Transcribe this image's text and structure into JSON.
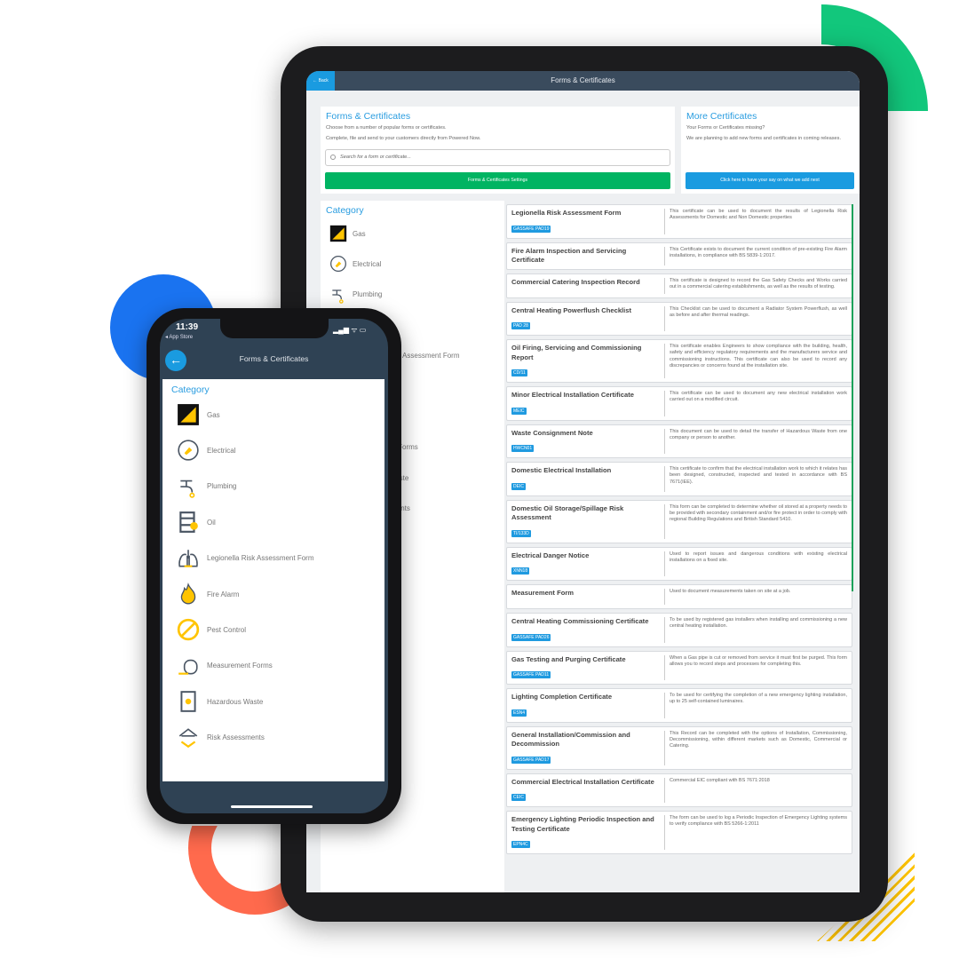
{
  "colors": {
    "accent": "#1a9be0",
    "green": "#00b462",
    "header": "#3a4b5d",
    "brand_yellow": "#ffc400"
  },
  "tablet": {
    "header": {
      "back_label": "← Back",
      "title": "Forms & Certificates"
    },
    "intro": {
      "title": "Forms & Certificates",
      "line1": "Choose from a number of popular forms or certificates.",
      "line2": "Complete, file and send to your customers directly from Powered Now.",
      "search_placeholder": "Search for a form or certificate...",
      "settings_button": "Forms & Certificates Settings"
    },
    "more": {
      "title": "More Certificates",
      "line1": "Your Forms or Certificates missing?",
      "line2": "We are planning to add new forms and certificates in coming releases.",
      "button": "Click here to have your say on what we add next"
    },
    "category_title": "Category",
    "forms": [
      {
        "title": "Legionella Risk Assessment Form",
        "tag": "GASSAFE PAD19",
        "desc": "This certificate can be used to document the results of Legionella Risk Assessments for Domestic and Non Domestic properties"
      },
      {
        "title": "Fire Alarm Inspection and Servicing Certificate",
        "tag": "",
        "desc": "This Certificate exists to document the current condition of pre-existing Fire Alarm installations, in compliance with BS 5839-1:2017."
      },
      {
        "title": "Commercial Catering Inspection Record",
        "tag": "",
        "desc": "This certificate is designed to record the Gas Safety Checks and Works carried out in a commercial catering establishments, as well as the results of testing."
      },
      {
        "title": "Central Heating Powerflush Checklist",
        "tag": "PAD 28",
        "desc": "This Checklist can be used to document a Radiator System Powerflush, as well as before and after thermal readings."
      },
      {
        "title": "Oil Firing, Servicing and Commissioning Report",
        "tag": "CD/11",
        "desc": "This certificate enables Engineers to show compliance with the building, health, safety and efficiency regulatory requirements and the manufacturers service and commissioning instructions. This certificate can also be used to record any discrepancies or concerns found at the installation site."
      },
      {
        "title": "Minor Electrical Installation Certificate",
        "tag": "MEIC",
        "desc": "This certificate can be used to document any new electrical installation work carried out on a modified circuit."
      },
      {
        "title": "Waste Consignment Note",
        "tag": "HWCN01",
        "desc": "This document can be used to detail the transfer of Hazardous Waste from one company or person to another."
      },
      {
        "title": "Domestic Electrical Installation",
        "tag": "DEIC",
        "desc": "This certificate to confirm that the electrical installation work to which it relates has been designed, constructed, inspected and tested in accordance with BS 7671(IEE)."
      },
      {
        "title": "Domestic Oil Storage/Spillage Risk Assessment",
        "tag": "TI/133D",
        "desc": "This form can be completed to determine whether oil stored at a property needs to be provided with secondary containment and/or fire protect in order to comply with regional Building Regulations and British Standard 5410."
      },
      {
        "title": "Electrical Danger Notice",
        "tag": "XNN18",
        "desc": "Used to report issues and dangerous conditions with existing electrical installations on a fixed site."
      },
      {
        "title": "Measurement Form",
        "tag": "",
        "desc": "Used to document measurements taken on site at a job."
      },
      {
        "title": "Central Heating Commissioning Certificate",
        "tag": "GASSAFE PAD26",
        "desc": "To be used by registered gas installers when installing and commissioning a new central heating installation."
      },
      {
        "title": "Gas Testing and Purging Certificate",
        "tag": "GASSAFE PAD11",
        "desc": "When a Gas pipe is cut or removed from service it must first be purged. This form allows you to record steps and processes for completing this."
      },
      {
        "title": "Lighting Completion Certificate",
        "tag": "ESN4",
        "desc": "To be used for certifying the completion of a new emergency lighting installation, up to 25 self-contained luminaires."
      },
      {
        "title": "General Installation/Commission and Decommission",
        "tag": "GASSAFE PAD17",
        "desc": "This Record can be completed with the options of Installation, Commissioning, Decommissioning, within different markets such as Domestic, Commercial or Catering."
      },
      {
        "title": "Commercial Electrical Installation Certificate",
        "tag": "CEIC",
        "desc": "Commercial EIC compliant with BS 7671:2018"
      },
      {
        "title": "Emergency Lighting Periodic Inspection and Testing Certificate",
        "tag": "EPN4C",
        "desc": "The form can be used to log a Periodic Inspection of Emergency Lighting systems to verify compliance with BS 5266-1:2011"
      }
    ]
  },
  "categories": [
    {
      "label": "Gas",
      "icon": "gas-safe-icon"
    },
    {
      "label": "Electrical",
      "icon": "plug-icon"
    },
    {
      "label": "Plumbing",
      "icon": "tap-icon"
    },
    {
      "label": "Oil",
      "icon": "oil-barrel-icon"
    },
    {
      "label": "Legionella Risk Assessment Form",
      "icon": "lungs-icon"
    },
    {
      "label": "Fire Alarm",
      "icon": "flame-icon"
    },
    {
      "label": "Pest Control",
      "icon": "no-pest-icon"
    },
    {
      "label": "Measurement Forms",
      "icon": "tape-measure-icon"
    },
    {
      "label": "Hazardous Waste",
      "icon": "waste-barrel-icon"
    },
    {
      "label": "Risk Assessments",
      "icon": "house-icon"
    }
  ],
  "phone": {
    "time": "11:39",
    "back_app": "◂ App Store",
    "status_icons": "▂▄▆ ᯤ ▭",
    "back_icon": "←",
    "title": "Forms & Certificates",
    "category_title": "Category"
  }
}
